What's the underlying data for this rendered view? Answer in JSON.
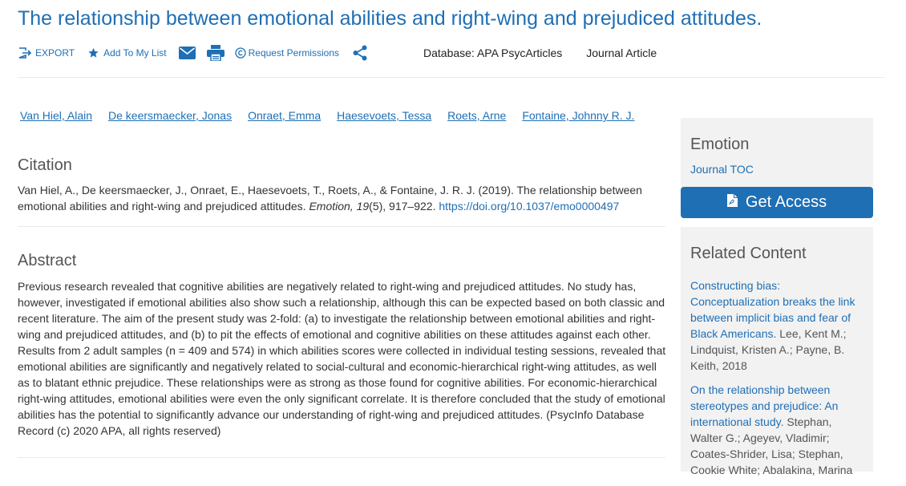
{
  "article": {
    "title": "The relationship between emotional abilities and right-wing and prejudiced attitudes."
  },
  "toolbar": {
    "export_label": "EXPORT",
    "add_to_list_label": "Add To My List",
    "request_permissions_label": "Request Permissions",
    "database_label": "Database: APA PsycArticles",
    "doc_type_label": "Journal Article"
  },
  "authors": [
    "Van Hiel, Alain",
    "De keersmaecker, Jonas",
    "Onraet, Emma",
    "Haesevoets, Tessa",
    "Roets, Arne",
    "Fontaine, Johnny R. J."
  ],
  "citation": {
    "heading": "Citation",
    "text_before": "Van Hiel, A., De keersmaecker, J., Onraet, E., Haesevoets, T., Roets, A., & Fontaine, J. R. J. (2019). The relationship between emotional abilities and right-wing and prejudiced attitudes. ",
    "journal_volume": "Emotion, 19",
    "text_after": "(5), 917–922. ",
    "doi": "https://doi.org/10.1037/emo0000497"
  },
  "abstract": {
    "heading": "Abstract",
    "text": "Previous research revealed that cognitive abilities are negatively related to right-wing and prejudiced attitudes. No study has, however, investigated if emotional abilities also show such a relationship, although this can be expected based on both classic and recent literature. The aim of the present study was 2-fold: (a) to investigate the relationship between emotional abilities and right-wing and prejudiced attitudes, and (b) to pit the effects of emotional and cognitive abilities on these attitudes against each other. Results from 2 adult samples (n = 409 and 574) in which abilities scores were collected in individual testing sessions, revealed that emotional abilities are significantly and negatively related to social-cultural and economic-hierarchical right-wing attitudes, as well as to blatant ethnic prejudice. These relationships were as strong as those found for cognitive abilities. For economic-hierarchical right-wing attitudes, emotional abilities were even the only significant correlate. It is therefore concluded that the study of emotional abilities has the potential to significantly advance our understanding of right-wing and prejudiced attitudes. (PsycInfo Database Record (c) 2020 APA, all rights reserved)"
  },
  "sidebar": {
    "journal_name": "Emotion",
    "journal_toc_label": "Journal TOC",
    "get_access_label": "Get Access",
    "related_heading": "Related Content",
    "related": [
      {
        "title": "Constructing bias: Conceptualization breaks the link between implicit bias and fear of Black Americans.",
        "meta": " Lee, Kent M.; Lindquist, Kristen A.; Payne, B. Keith, 2018"
      },
      {
        "title": "On the relationship between stereotypes and prejudice: An international study.",
        "meta": " Stephan, Walter G.; Ageyev, Vladimir; Coates-Shrider, Lisa; Stephan, Cookie White; Abalakina, Marina"
      }
    ]
  },
  "colors": {
    "link": "#1f6fb5",
    "button_bg": "#1f6fb5",
    "sidebar_bg": "#f2f2f2"
  }
}
